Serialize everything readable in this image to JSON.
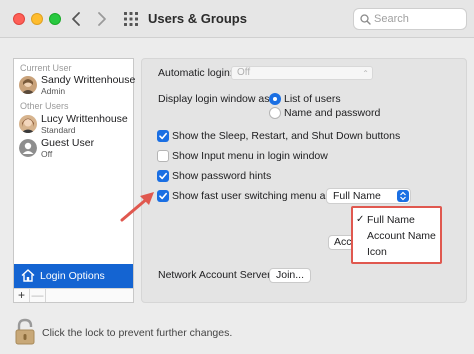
{
  "window": {
    "title": "Users & Groups"
  },
  "search": {
    "placeholder": "Search"
  },
  "sidebar": {
    "current_user_label": "Current User",
    "other_users_label": "Other Users",
    "users": [
      {
        "name": "Sandy Writtenhouse",
        "role": "Admin"
      },
      {
        "name": "Lucy Writtenhouse",
        "role": "Standard"
      },
      {
        "name": "Guest User",
        "role": "Off"
      }
    ],
    "login_options_label": "Login Options",
    "add_label": "+",
    "remove_label": "—"
  },
  "panel": {
    "automatic_login_label": "Automatic login:",
    "automatic_login_value": "Off",
    "display_login_label": "Display login window as:",
    "radio_list_of_users": "List of users",
    "radio_name_and_password": "Name and password",
    "check_sleep_restart": "Show the Sleep, Restart, and Shut Down buttons",
    "check_input_menu": "Show Input menu in login window",
    "check_password_hints": "Show password hints",
    "check_fast_switching": "Show fast user switching menu as",
    "fast_switching_value": "Full Name",
    "accessibility_button_partial": "Acc",
    "network_server_label": "Network Account Server:",
    "join_button": "Join..."
  },
  "menu": {
    "items": [
      {
        "label": "Full Name",
        "checked": "✓"
      },
      {
        "label": "Account Name",
        "checked": ""
      },
      {
        "label": "Icon",
        "checked": ""
      }
    ]
  },
  "footer": {
    "lock_text": "Click the lock to prevent further changes."
  },
  "colors": {
    "accent": "#1a6fe3",
    "selection": "#1464d2",
    "highlight_border": "#e0584f"
  }
}
